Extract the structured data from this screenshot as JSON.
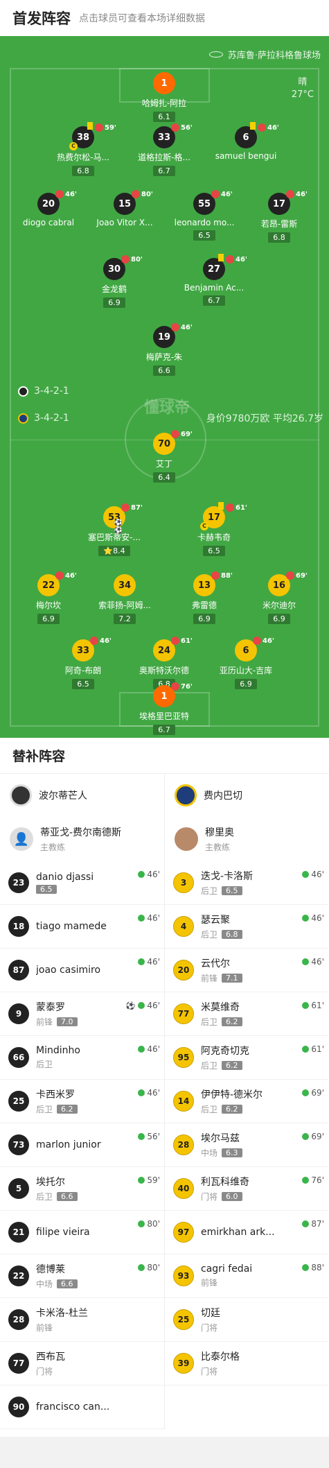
{
  "header": {
    "title": "首发阵容",
    "subtitle": "点击球员可查看本场详细数据"
  },
  "pitch": {
    "venue": "苏库鲁·萨拉科格鲁球场",
    "weather": "晴",
    "temperature": "27°C",
    "watermark": "懂球帝",
    "home_formation": "3-4-2-1",
    "away_formation": "3-4-2-1",
    "team_value": "身价9780万欧 平均26.7岁"
  },
  "home_players": [
    {
      "num": "1",
      "name": "哈姆扎-阿拉",
      "rating": "6.1"
    },
    {
      "num": "38",
      "name": "热费尔松-马...",
      "rating": "6.8",
      "sub": "59'"
    },
    {
      "num": "33",
      "name": "道格拉斯-格...",
      "rating": "6.7",
      "sub": "56'"
    },
    {
      "num": "6",
      "name": "samuel bengui",
      "sub": "46'"
    },
    {
      "num": "20",
      "name": "diogo cabral",
      "sub": "46'"
    },
    {
      "num": "15",
      "name": "Joao Vitor X...",
      "sub": "80'"
    },
    {
      "num": "55",
      "name": "leonardo mo...",
      "rating": "6.5",
      "sub": "46'"
    },
    {
      "num": "17",
      "name": "若昂-雷斯",
      "rating": "6.8",
      "sub": "46'"
    },
    {
      "num": "30",
      "name": "金龙鹤",
      "rating": "6.9",
      "sub": "80'"
    },
    {
      "num": "27",
      "name": "Benjamin Ac...",
      "rating": "6.7",
      "sub": "46'"
    },
    {
      "num": "19",
      "name": "梅萨克-朱",
      "rating": "6.6",
      "sub": "46'"
    }
  ],
  "away_players": [
    {
      "num": "70",
      "name": "艾丁",
      "rating": "6.4",
      "sub": "69'"
    },
    {
      "num": "53",
      "name": "塞巴斯蒂安-...",
      "rating": "8.4",
      "sub": "87'"
    },
    {
      "num": "17",
      "name": "卡赫韦奇",
      "rating": "6.5",
      "sub": "61'"
    },
    {
      "num": "22",
      "name": "梅尔坎",
      "rating": "6.9",
      "sub": "46'"
    },
    {
      "num": "34",
      "name": "索菲扬-阿姆...",
      "rating": "7.2"
    },
    {
      "num": "13",
      "name": "弗雷德",
      "rating": "6.9",
      "sub": "88'"
    },
    {
      "num": "16",
      "name": "米尔迪尔",
      "rating": "6.9",
      "sub": "69'"
    },
    {
      "num": "33",
      "name": "阿奇-布朗",
      "rating": "6.5",
      "sub": "46'"
    },
    {
      "num": "24",
      "name": "奥斯特沃尔德",
      "rating": "6.8",
      "sub": "61'"
    },
    {
      "num": "6",
      "name": "亚历山大-吉库",
      "rating": "6.9",
      "sub": "46'"
    },
    {
      "num": "1",
      "name": "埃格里巴亚特",
      "rating": "6.7",
      "sub": "76'"
    }
  ],
  "subs": {
    "title": "替补阵容",
    "home": {
      "team": "波尔蒂芒人",
      "coach": {
        "name": "蒂亚戈-费尔南德斯",
        "role": "主教练"
      },
      "players": [
        {
          "num": "23",
          "name": "danio djassi",
          "rating": "6.5",
          "time": "46'"
        },
        {
          "num": "18",
          "name": "tiago mamede",
          "time": "46'"
        },
        {
          "num": "87",
          "name": "joao casimiro",
          "time": "46'"
        },
        {
          "num": "9",
          "name": "蒙泰罗",
          "pos": "前锋",
          "rating": "7.0",
          "time": "46'",
          "goal": "⚽"
        },
        {
          "num": "66",
          "name": "Mindinho",
          "pos": "后卫",
          "time": "46'"
        },
        {
          "num": "25",
          "name": "卡西米罗",
          "pos": "后卫",
          "rating": "6.2",
          "time": "46'"
        },
        {
          "num": "73",
          "name": "marlon junior",
          "time": "56'"
        },
        {
          "num": "5",
          "name": "埃托尔",
          "pos": "后卫",
          "rating": "6.6",
          "time": "59'"
        },
        {
          "num": "21",
          "name": "filipe vieira",
          "time": "80'"
        },
        {
          "num": "22",
          "name": "德博莱",
          "pos": "中场",
          "rating": "6.6",
          "time": "80'"
        },
        {
          "num": "28",
          "name": "卡米洛-杜兰",
          "pos": "前锋"
        },
        {
          "num": "77",
          "name": "西布瓦",
          "pos": "门将"
        },
        {
          "num": "90",
          "name": "francisco can..."
        }
      ]
    },
    "away": {
      "team": "费内巴切",
      "coach": {
        "name": "穆里奥",
        "role": "主教练"
      },
      "players": [
        {
          "num": "3",
          "name": "迭戈-卡洛斯",
          "pos": "后卫",
          "rating": "6.5",
          "time": "46'"
        },
        {
          "num": "4",
          "name": "瑟云聚",
          "pos": "后卫",
          "rating": "6.8",
          "time": "46'"
        },
        {
          "num": "20",
          "name": "云代尔",
          "pos": "前锋",
          "rating": "7.1",
          "time": "46'"
        },
        {
          "num": "77",
          "name": "米莫维奇",
          "pos": "后卫",
          "rating": "6.2",
          "time": "61'"
        },
        {
          "num": "95",
          "name": "阿克奇切克",
          "pos": "后卫",
          "rating": "6.2",
          "time": "61'"
        },
        {
          "num": "14",
          "name": "伊伊特-德米尔",
          "pos": "后卫",
          "rating": "6.2",
          "time": "69'"
        },
        {
          "num": "28",
          "name": "埃尔马兹",
          "pos": "中场",
          "rating": "6.3",
          "time": "69'"
        },
        {
          "num": "40",
          "name": "利瓦科维奇",
          "pos": "门将",
          "rating": "6.0",
          "time": "76'"
        },
        {
          "num": "97",
          "name": "emirkhan ark...",
          "time": "87'"
        },
        {
          "num": "93",
          "name": "cagri fedai",
          "pos": "前锋",
          "time": "88'"
        },
        {
          "num": "25",
          "name": "切廷",
          "pos": "门将"
        },
        {
          "num": "39",
          "name": "比泰尔格",
          "pos": "门将"
        }
      ]
    }
  }
}
